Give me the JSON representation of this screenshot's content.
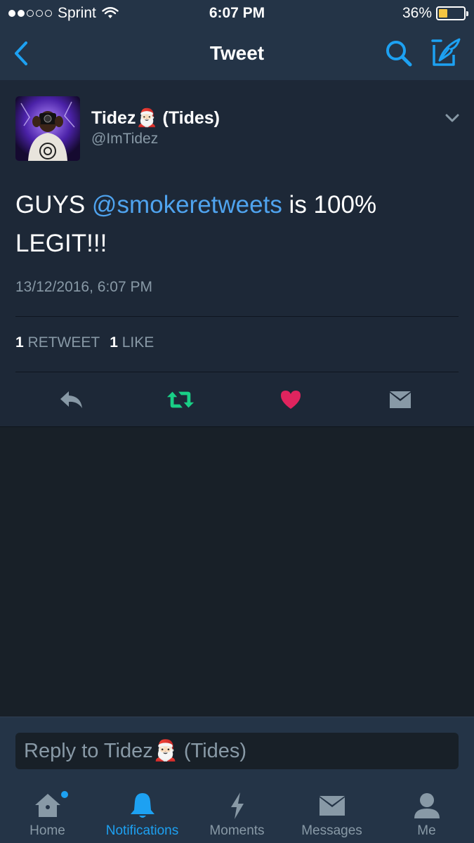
{
  "status_bar": {
    "carrier": "Sprint",
    "time": "6:07 PM",
    "battery": "36%",
    "battery_level": 0.36,
    "signal_bars": 2
  },
  "nav": {
    "title": "Tweet",
    "back_icon": "chevron-left-icon",
    "search_icon": "search-icon",
    "compose_icon": "compose-tweet-icon"
  },
  "tweet": {
    "display_name": "Tidez🎅🏻 (Tides)",
    "handle": "@ImTidez",
    "text_before": "GUYS ",
    "mention": "@smokeretweets",
    "text_after": " is 100% LEGIT!!!",
    "timestamp": "13/12/2016, 6:07 PM",
    "retweets_count": "1",
    "retweets_label": "RETWEET",
    "likes_count": "1",
    "likes_label": "LIKE"
  },
  "reply": {
    "placeholder": "Reply to Tidez🎅🏻 (Tides)"
  },
  "tabs": [
    {
      "label": "Home",
      "icon": "home-icon"
    },
    {
      "label": "Notifications",
      "icon": "bell-icon"
    },
    {
      "label": "Moments",
      "icon": "lightning-icon"
    },
    {
      "label": "Messages",
      "icon": "envelope-icon"
    },
    {
      "label": "Me",
      "icon": "person-icon"
    }
  ],
  "colors": {
    "accent": "#1da1f2",
    "retweet": "#19cf86",
    "like": "#e0245e",
    "background": "#182028",
    "bar": "#243447"
  }
}
